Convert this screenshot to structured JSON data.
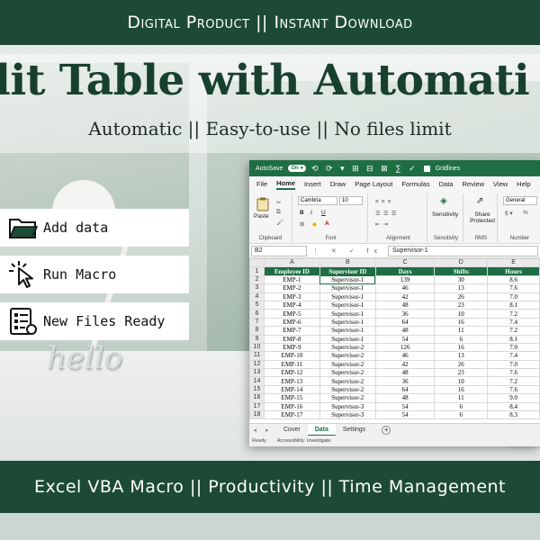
{
  "top_banner": "Digital Product || Instant Download",
  "headline": {
    "title": "lit Table with Automati",
    "subtitle": "Automatic || Easy-to-use || No files limit"
  },
  "scene": {
    "sign_text": "hello"
  },
  "steps": [
    {
      "label": "Add data",
      "icon": "folder-icon"
    },
    {
      "label": "Run Macro",
      "icon": "cursor-click-icon"
    },
    {
      "label": "New Files Ready",
      "icon": "document-list-icon"
    }
  ],
  "excel": {
    "autosave_label": "AutoSave",
    "autosave_state": "On",
    "gridlines_label": "Gridlines",
    "menu": [
      "File",
      "Home",
      "Insert",
      "Draw",
      "Page Layout",
      "Formulas",
      "Data",
      "Review",
      "View",
      "Help"
    ],
    "ribbon": {
      "paste": "Paste",
      "clipboard": "Clipboard",
      "font_name": "Cambria",
      "font_size": "10",
      "font": "Font",
      "alignment": "Alignment",
      "sensitivity": "Sensitivity",
      "sensitivity_group": "Sensitivity",
      "share": "Share Protected",
      "rms": "RMS",
      "number_format": "General",
      "number": "Number"
    },
    "name_box": "B2",
    "formula_value": "Supervisor-1",
    "columns": [
      "A",
      "B",
      "C",
      "D",
      "E"
    ],
    "headers": [
      "Employee ID",
      "Supervisor ID",
      "Days",
      "Shifts",
      "Hours"
    ],
    "rows": [
      [
        "EMP-1",
        "Supervisor-1",
        "139",
        "30",
        "8.6"
      ],
      [
        "EMP-2",
        "Supervisor-1",
        "46",
        "13",
        "7.6"
      ],
      [
        "EMP-3",
        "Supervisor-1",
        "42",
        "26",
        "7.0"
      ],
      [
        "EMP-4",
        "Supervisor-1",
        "48",
        "23",
        "8.1"
      ],
      [
        "EMP-5",
        "Supervisor-1",
        "36",
        "10",
        "7.2"
      ],
      [
        "EMP-6",
        "Supervisor-1",
        "64",
        "16",
        "7.4"
      ],
      [
        "EMP-7",
        "Supervisor-1",
        "48",
        "11",
        "7.2"
      ],
      [
        "EMP-8",
        "Supervisor-1",
        "54",
        "6",
        "8.1"
      ],
      [
        "EMP-9",
        "Supervisor-2",
        "126",
        "16",
        "7.0"
      ],
      [
        "EMP-10",
        "Supervisor-2",
        "46",
        "13",
        "7.4"
      ],
      [
        "EMP-11",
        "Supervisor-2",
        "42",
        "26",
        "7.0"
      ],
      [
        "EMP-12",
        "Supervisor-2",
        "48",
        "23",
        "7.6"
      ],
      [
        "EMP-13",
        "Supervisor-2",
        "36",
        "10",
        "7.2"
      ],
      [
        "EMP-14",
        "Supervisor-2",
        "64",
        "16",
        "7.6"
      ],
      [
        "EMP-15",
        "Supervisor-2",
        "48",
        "11",
        "9.0"
      ],
      [
        "EMP-16",
        "Supervisor-3",
        "54",
        "6",
        "8.4"
      ],
      [
        "EMP-17",
        "Supervisor-3",
        "54",
        "6",
        "8.3"
      ]
    ],
    "sheet_tabs": [
      "Cover",
      "Data",
      "Settings"
    ],
    "active_tab": "Data",
    "status_ready": "Ready",
    "status_accessibility": "Accessibility: Investigate"
  },
  "bottom_banner": "Excel VBA Macro || Productivity || Time Management",
  "colors": {
    "brand_green": "#1d4a36",
    "excel_green": "#1f6e43",
    "title_green": "#18402e"
  }
}
